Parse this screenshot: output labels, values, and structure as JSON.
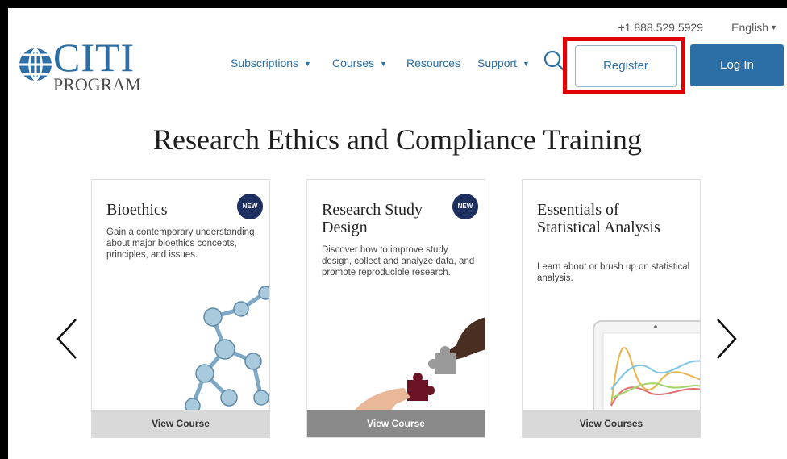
{
  "header": {
    "logo": {
      "brand": "CITI",
      "sub": "PROGRAM"
    },
    "phone": "+1 888.529.5929",
    "language": "English",
    "nav": [
      {
        "label": "Subscriptions",
        "has_dropdown": true
      },
      {
        "label": "Courses",
        "has_dropdown": true
      },
      {
        "label": "Resources",
        "has_dropdown": false
      },
      {
        "label": "Support",
        "has_dropdown": true
      }
    ],
    "register_label": "Register",
    "login_label": "Log In"
  },
  "main": {
    "heading": "Research Ethics and Compliance Training",
    "cards": [
      {
        "title": "Bioethics",
        "badge": "NEW",
        "description": "Gain a contemporary understanding about major bioethics concepts, principles, and issues.",
        "footer": "View Course",
        "image": "molecule-image"
      },
      {
        "title": "Research Study Design",
        "badge": "NEW",
        "description": "Discover how to improve study design, collect and analyze data, and promote reproducible research.",
        "footer": "View Course",
        "image": "puzzle-hands-image"
      },
      {
        "title": "Essentials of Statistical Analysis",
        "badge": "",
        "description": "Learn about or brush up on statistical analysis.",
        "footer": "View Courses",
        "image": "tablet-graph-image"
      }
    ]
  },
  "colors": {
    "brand_blue": "#2c6fa6",
    "badge_navy": "#1c2f5e",
    "highlight_red": "#e00000"
  },
  "icons": {
    "search": "search-icon",
    "prev": "chevron-left-icon",
    "next": "chevron-right-icon"
  }
}
